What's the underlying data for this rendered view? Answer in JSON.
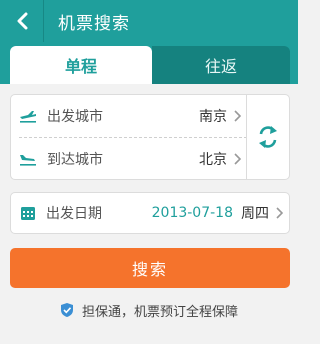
{
  "header": {
    "title": "机票搜索"
  },
  "tabs": [
    {
      "label": "单程",
      "active": true
    },
    {
      "label": "往返",
      "active": false
    }
  ],
  "cities": {
    "departure_label": "出发城市",
    "departure_value": "南京",
    "arrival_label": "到达城市",
    "arrival_value": "北京"
  },
  "date": {
    "label": "出发日期",
    "value": "2013-07-18",
    "weekday": "周四"
  },
  "search_button": "搜索",
  "guarantee_text": "担保通，机票预订全程保障",
  "colors": {
    "primary": "#1f9f9c",
    "accent": "#f5732c"
  },
  "icons": [
    "back-arrow-icon",
    "takeoff-icon",
    "landing-icon",
    "swap-icon",
    "calendar-icon",
    "shield-icon",
    "chevron-right-icon"
  ]
}
